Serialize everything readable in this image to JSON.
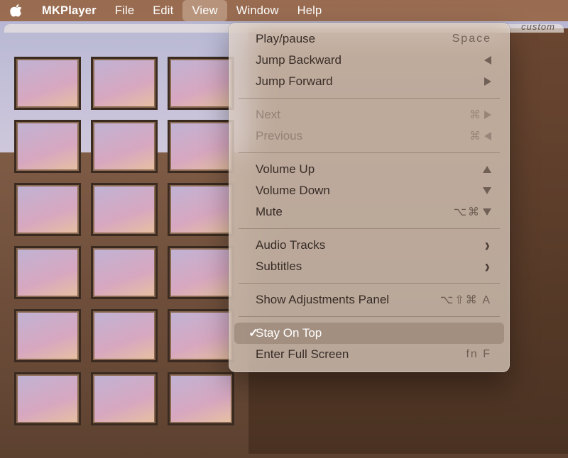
{
  "menubar": {
    "app_name": "MKPlayer",
    "items": [
      "File",
      "Edit",
      "View",
      "Window",
      "Help"
    ],
    "active_index": 2
  },
  "subbar": {
    "right_text": "custom"
  },
  "dropdown": {
    "groups": [
      [
        {
          "label": "Play/pause",
          "shortcut_text": "Space",
          "disabled": false
        },
        {
          "label": "Jump Backward",
          "shortcut_glyph": "tri-left",
          "disabled": false
        },
        {
          "label": "Jump Forward",
          "shortcut_glyph": "tri-right",
          "disabled": false
        }
      ],
      [
        {
          "label": "Next",
          "shortcut_text": "⌘",
          "shortcut_glyph": "tri-right",
          "disabled": true
        },
        {
          "label": "Previous",
          "shortcut_text": "⌘",
          "shortcut_glyph": "tri-left",
          "disabled": true
        }
      ],
      [
        {
          "label": "Volume Up",
          "shortcut_glyph": "tri-up",
          "disabled": false
        },
        {
          "label": "Volume Down",
          "shortcut_glyph": "tri-down",
          "disabled": false
        },
        {
          "label": "Mute",
          "shortcut_text": "⌥⌘",
          "shortcut_glyph": "tri-down",
          "disabled": false
        }
      ],
      [
        {
          "label": "Audio Tracks",
          "submenu": true
        },
        {
          "label": "Subtitles",
          "submenu": true
        }
      ],
      [
        {
          "label": "Show Adjustments Panel",
          "shortcut_text": "⌥⇧⌘ A",
          "disabled": false
        }
      ],
      [
        {
          "label": "Stay On Top",
          "checked": true,
          "highlight": true
        },
        {
          "label": "Enter Full Screen",
          "shortcut_text": "fn F",
          "disabled": false
        }
      ]
    ]
  }
}
